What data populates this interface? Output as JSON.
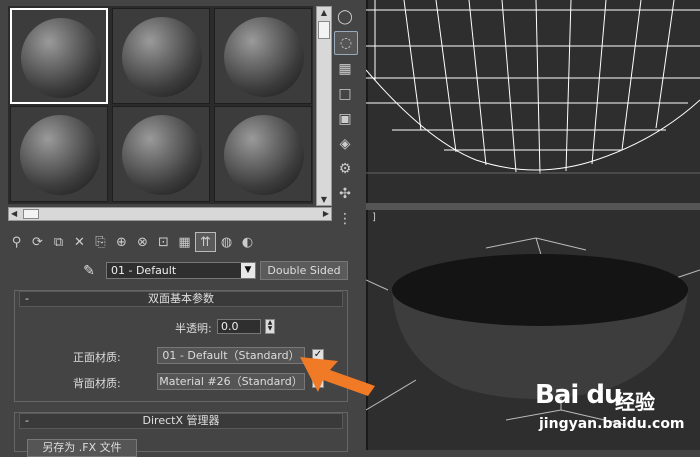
{
  "toolbar": {
    "material_name": "01 - Default",
    "type_button": "Double Sided"
  },
  "rollout": {
    "title": "双面基本参数",
    "translucency_label": "半透明:",
    "translucency_value": "0.0",
    "facing_label": "正面材质:",
    "facing_material": "01 - Default（Standard）",
    "facing_checked": "✓",
    "back_label": "背面材质:",
    "back_material": "Material #26（Standard）",
    "back_checked": "✓",
    "minus": "-"
  },
  "directx": {
    "title": "DirectX 管理器",
    "minus": "-",
    "save_button": "另存为 .FX 文件"
  },
  "viewport": {
    "bracket": "]"
  },
  "watermark": {
    "brand": "Bai  du",
    "product": "经验",
    "url": "jingyan.baidu.com"
  },
  "colors": {
    "arrow": "#f07a25",
    "bowl": "#141414"
  }
}
